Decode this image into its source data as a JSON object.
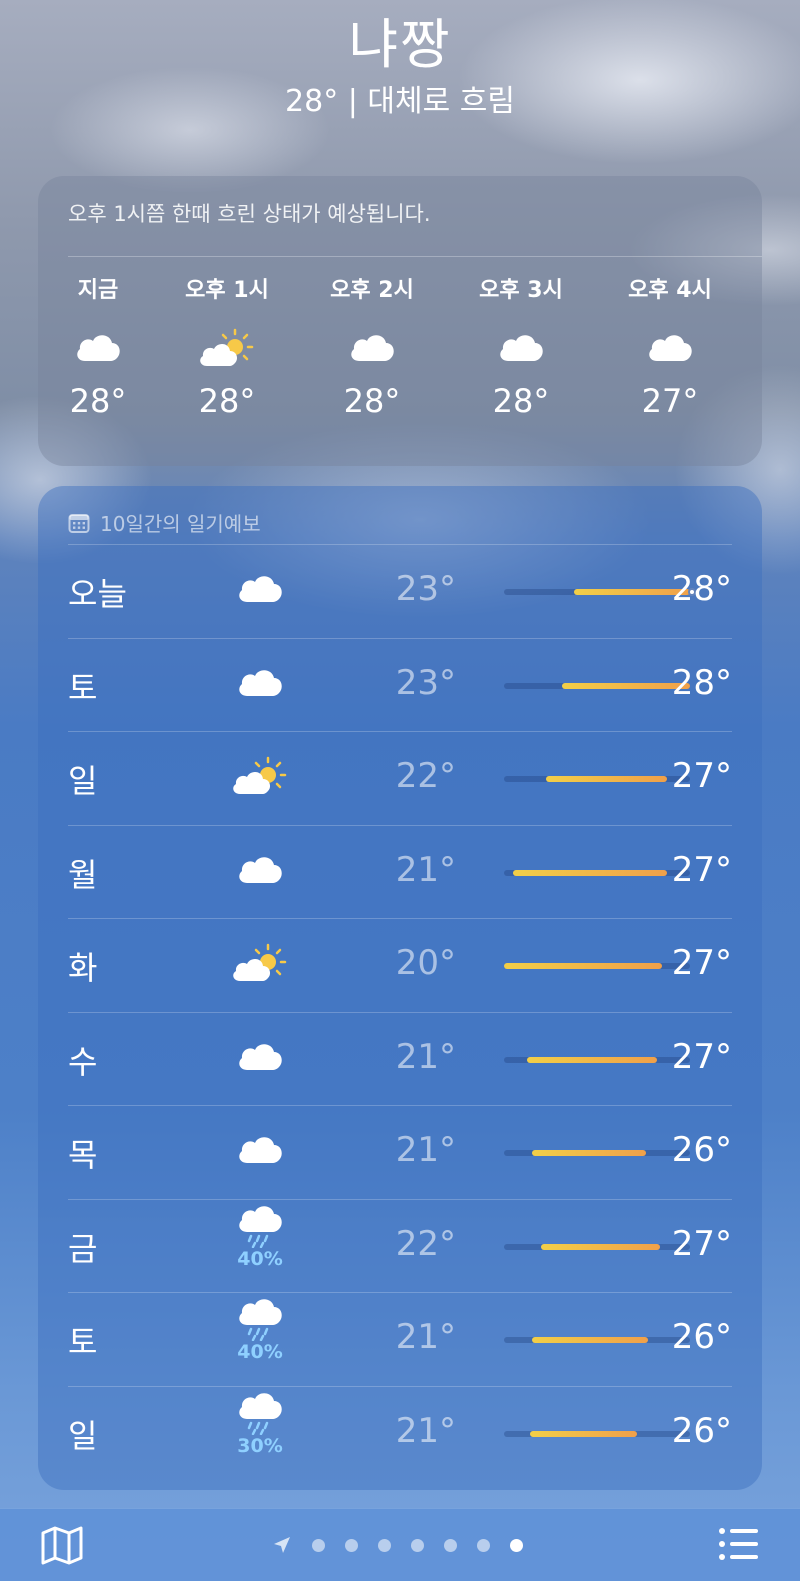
{
  "location": {
    "city": "냐짱",
    "subtitle": "28° | 대체로 흐림"
  },
  "hourly": {
    "summary": "오후 1시쯤 한때 흐린 상태가 예상됩니다.",
    "items": [
      {
        "label": "지금",
        "icon": "cloud-icon",
        "temp": "28°"
      },
      {
        "label": "오후 1시",
        "icon": "partly-sunny-icon",
        "temp": "28°"
      },
      {
        "label": "오후 2시",
        "icon": "cloud-icon",
        "temp": "28°"
      },
      {
        "label": "오후 3시",
        "icon": "cloud-icon",
        "temp": "28°"
      },
      {
        "label": "오후 4시",
        "icon": "cloud-icon",
        "temp": "27°"
      }
    ]
  },
  "daily": {
    "header": "10일간의 일기예보",
    "range_min": 20,
    "range_max": 28,
    "days": [
      {
        "name": "오늘",
        "icon": "cloud-icon",
        "pop": "",
        "low": "23°",
        "high": "28°",
        "low_v": 23,
        "high_v": 28,
        "current_v": 28
      },
      {
        "name": "토",
        "icon": "cloud-icon",
        "pop": "",
        "low": "23°",
        "high": "28°",
        "low_v": 22.5,
        "high_v": 28
      },
      {
        "name": "일",
        "icon": "partly-sunny-icon",
        "pop": "",
        "low": "22°",
        "high": "27°",
        "low_v": 21.8,
        "high_v": 27
      },
      {
        "name": "월",
        "icon": "cloud-icon",
        "pop": "",
        "low": "21°",
        "high": "27°",
        "low_v": 20.4,
        "high_v": 27
      },
      {
        "name": "화",
        "icon": "partly-sunny-icon",
        "pop": "",
        "low": "20°",
        "high": "27°",
        "low_v": 20,
        "high_v": 26.8
      },
      {
        "name": "수",
        "icon": "cloud-icon",
        "pop": "",
        "low": "21°",
        "high": "27°",
        "low_v": 21,
        "high_v": 26.6
      },
      {
        "name": "목",
        "icon": "cloud-icon",
        "pop": "",
        "low": "21°",
        "high": "26°",
        "low_v": 21.2,
        "high_v": 26.1
      },
      {
        "name": "금",
        "icon": "rain-icon",
        "pop": "40%",
        "low": "22°",
        "high": "27°",
        "low_v": 21.6,
        "high_v": 26.7
      },
      {
        "name": "토",
        "icon": "rain-icon",
        "pop": "40%",
        "low": "21°",
        "high": "26°",
        "low_v": 21.2,
        "high_v": 26.2
      },
      {
        "name": "일",
        "icon": "rain-icon",
        "pop": "30%",
        "low": "21°",
        "high": "26°",
        "low_v": 21.1,
        "high_v": 25.7
      }
    ]
  },
  "toolbar": {
    "map_icon": "map-icon",
    "list_icon": "list-icon",
    "page_count": 7,
    "active_page": 7
  },
  "colors": {
    "bar_start": "#f2cf48",
    "bar_end": "#f0a04a",
    "precip": "#8fd0ff"
  }
}
